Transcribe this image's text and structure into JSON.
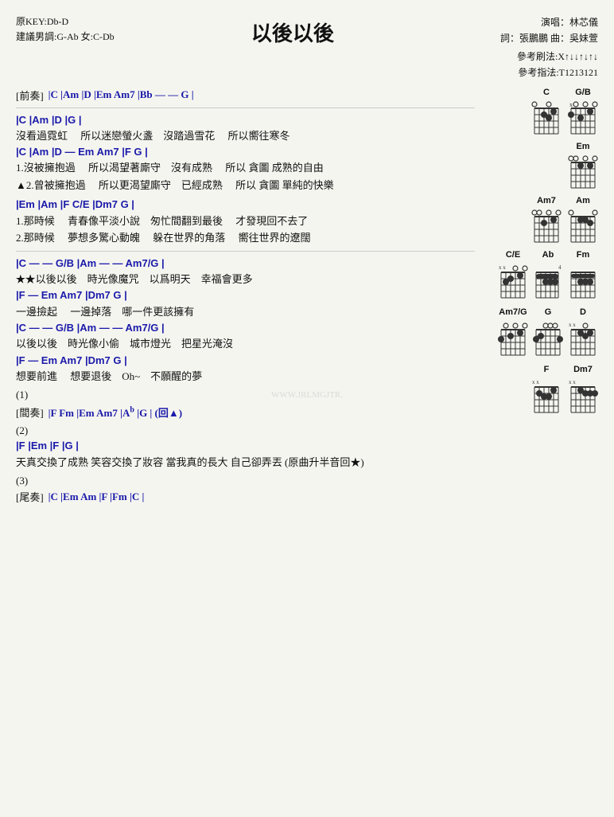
{
  "header": {
    "original_key": "原KEY:Db-D",
    "suggested_key": "建議男調:G-Ab 女:C-Db",
    "title": "以後以後",
    "singer": "演唱：林芯儀",
    "lyricist": "詞：張鵬鵬  曲：吳妹萱",
    "strum_pattern": "參考刷法:X↑↓↓↑↓↑↓",
    "finger_pattern": "參考指法:T1213121"
  },
  "intro": {
    "label": "[前奏]",
    "chords": "|C  |Am  |D  |Em  Am7  |Bb — — G  |"
  },
  "verse1": {
    "chord_line1": "|C                  |Am              |D                   |G                |",
    "lyric1": "沒看過霓虹　  所以迷戀螢火盞　沒踏過雪花　 所以嚮往寒冬",
    "chord_line2": "  |C                       |Am              |D  —   Em  Am7   |F             G  |",
    "lyric2a": "1.沒被擁抱過　  所以渴望著廝守　沒有成熟　  所以  貪圖   成熟的自由",
    "lyric2b": "▲2.曾被擁抱過　  所以更渴望廝守　已經成熟　  所以  貪圖   單純的快樂"
  },
  "verse2": {
    "chord_line1": "  |Em                    |Am               |F  C/E             |Dm7    G  |",
    "lyric1a": "1.那時候　  青春像平淡小說　匆忙間翻到最後　 才發現回不去了",
    "lyric1b": "2.那時候　  夢想多驚心動魄　 躲在世界的角落　 嚮往世界的遼闊"
  },
  "chorus1": {
    "chord_line1": "  |C  —  —   G/B  |Am  —  —   Am7/G  |",
    "star_lyric": "★以後以後　時光像魔咒　以爲明天　幸福會更多",
    "chord_line2": "  |F  —    Em   Am7  |Dm7     G    |",
    "lyric2": "一邊撿起　  一邊掉落　哪一件更該擁有",
    "chord_line3": "  |C  —  —   G/B  |Am  —  —   Am7/G  |",
    "lyric3": "以後以後　時光像小偷　城市燈光　把星光淹沒",
    "chord_line4": "  |F  —    Em   Am7  |Dm7     G    |",
    "lyric4": "想要前進　  想要退後　Oh~　不願醒的夢"
  },
  "interlude": {
    "num": "(1)",
    "label": "[間奏]",
    "chords": "|F  Fm  |Em  Am7  |Ab  |G  |  (回▲)"
  },
  "section2": {
    "num": "(2)",
    "chord_line1": "|F              |Em             |F               |G          |",
    "lyric1": "天真交換了成熟  笑容交換了妝容  當我真的長大  自己卻弄丟 (原曲升半音回★)"
  },
  "outro": {
    "num": "(3)",
    "label": "[尾奏]",
    "chords": "|C  |Em  Am  |F  |Fm  |C  |"
  },
  "chord_diagrams": {
    "rows": [
      [
        {
          "name": "C",
          "frets": [
            0,
            3,
            2,
            0,
            1,
            0
          ],
          "open": [
            1,
            0,
            0,
            0,
            0,
            0
          ],
          "mute": [],
          "base": 1
        },
        {
          "name": "G/B",
          "frets": [
            2,
            0,
            0,
            0,
            1,
            0
          ],
          "open": [],
          "mute": [
            1,
            0,
            0,
            0,
            0,
            0
          ],
          "base": 1
        }
      ],
      [
        {
          "name": "Em",
          "frets": [
            0,
            2,
            2,
            0,
            0,
            0
          ],
          "open": [],
          "mute": [],
          "base": 1
        }
      ],
      [
        {
          "name": "Am7",
          "frets": [
            0,
            0,
            2,
            0,
            1,
            0
          ],
          "open": [],
          "mute": [],
          "base": 1
        },
        {
          "name": "Am",
          "frets": [
            0,
            0,
            2,
            2,
            1,
            0
          ],
          "open": [],
          "mute": [],
          "base": 1
        }
      ],
      [
        {
          "name": "C/E",
          "frets": [
            0,
            3,
            2,
            0,
            1,
            0
          ],
          "open": [],
          "mute": [
            1,
            1
          ],
          "base": 1
        },
        {
          "name": "Ab",
          "frets": [
            1,
            1,
            1,
            1,
            0,
            0
          ],
          "open": [],
          "mute": [],
          "base": 4
        },
        {
          "name": "Fm",
          "frets": [
            1,
            1,
            3,
            3,
            3,
            1
          ],
          "open": [],
          "mute": [],
          "base": 1
        }
      ],
      [
        {
          "name": "Am7/G",
          "frets": [
            3,
            0,
            2,
            0,
            1,
            0
          ],
          "open": [
            0,
            1,
            0,
            1,
            0,
            1
          ],
          "mute": [],
          "base": 1
        },
        {
          "name": "G",
          "frets": [
            3,
            2,
            0,
            0,
            0,
            3
          ],
          "open": [],
          "mute": [],
          "base": 1
        },
        {
          "name": "D",
          "frets": [
            0,
            0,
            0,
            2,
            3,
            2
          ],
          "open": [],
          "mute": [
            1,
            1
          ],
          "base": 1
        }
      ],
      [
        {
          "name": "F",
          "frets": [
            1,
            1,
            2,
            3,
            3,
            1
          ],
          "open": [],
          "mute": [
            1,
            1
          ],
          "base": 1
        },
        {
          "name": "Dm7",
          "frets": [
            0,
            0,
            0,
            2,
            1,
            1
          ],
          "open": [],
          "mute": [
            1,
            1
          ],
          "base": 1
        }
      ]
    ]
  }
}
